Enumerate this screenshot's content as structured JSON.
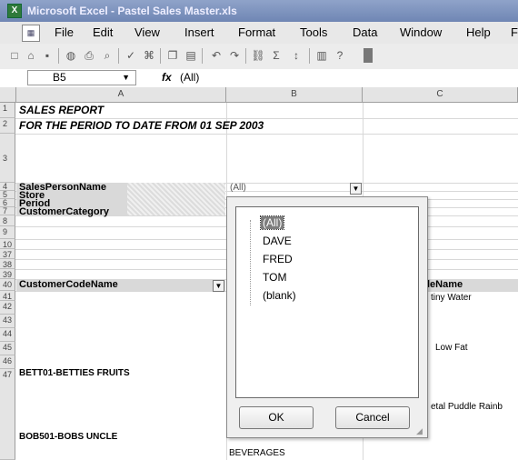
{
  "window": {
    "title": "Microsoft Excel - Pastel Sales Master.xls"
  },
  "menu": [
    "File",
    "Edit",
    "View",
    "Insert",
    "Format",
    "Tools",
    "Data",
    "Window",
    "Help"
  ],
  "menu_tail": "F",
  "formula": {
    "cell_ref": "B5",
    "fx": "fx",
    "value": "(All)"
  },
  "columns": [
    "A",
    "B",
    "C"
  ],
  "rows": [
    "1",
    "2",
    "3",
    "4",
    "5",
    "6",
    "7",
    "8",
    "9",
    "10",
    "37",
    "38",
    "39",
    "40",
    "41",
    "42",
    "43",
    "44",
    "45",
    "46",
    "47"
  ],
  "sheet": {
    "title": "SALES REPORT",
    "period_line": "FOR THE PERIOD TO DATE FROM  01 SEP 2003",
    "page_fields": [
      "SalesPersonName",
      "Store",
      "Period",
      "CustomerCategory"
    ],
    "page_value": "(All)",
    "row_field": "CustomerCodeName",
    "col_c_header": "leName",
    "c37": "tiny Water",
    "c40": "Low Fat",
    "a42": "BETT01-BETTIES FRUITS",
    "c44": "etal Puddle Rainb",
    "a46": "BOB501-BOBS UNCLE",
    "b47": "BEVERAGES"
  },
  "dropdown": {
    "options": [
      "(All)",
      "DAVE",
      "FRED",
      "TOM",
      "(blank)"
    ],
    "selected": "(All)",
    "ok": "OK",
    "cancel": "Cancel"
  },
  "colors": {
    "title_bar": "#7a8fbd",
    "selection": "#7d7d7d"
  }
}
